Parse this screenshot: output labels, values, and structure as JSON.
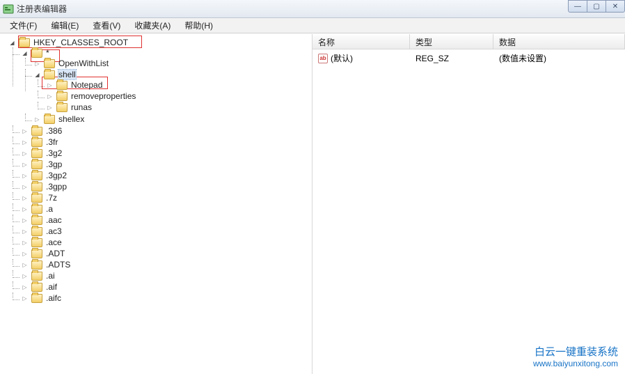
{
  "window": {
    "title": "注册表编辑器"
  },
  "menu": {
    "file": "文件(F)",
    "edit": "编辑(E)",
    "view": "查看(V)",
    "fav": "收藏夹(A)",
    "help": "帮助(H)"
  },
  "columns": {
    "name": "名称",
    "type": "类型",
    "data": "数据"
  },
  "values": [
    {
      "name": "(默认)",
      "type": "REG_SZ",
      "data": "(数值未设置)"
    }
  ],
  "tree": {
    "root": "HKEY_CLASSES_ROOT",
    "star": "*",
    "star_children": {
      "openwithlist": "OpenWithList",
      "shell": "shell",
      "shell_children": {
        "notepad": "Notepad",
        "removeproperties": "removeproperties",
        "runas": "runas"
      },
      "shellex": "shellex"
    },
    "siblings": [
      ".386",
      ".3fr",
      ".3g2",
      ".3gp",
      ".3gp2",
      ".3gpp",
      ".7z",
      ".a",
      ".aac",
      ".ac3",
      ".ace",
      ".ADT",
      ".ADTS",
      ".ai",
      ".aif",
      ".aifc"
    ]
  },
  "watermark": {
    "line1": "白云一键重装系统",
    "line2": "www.baiyunxitong.com"
  }
}
